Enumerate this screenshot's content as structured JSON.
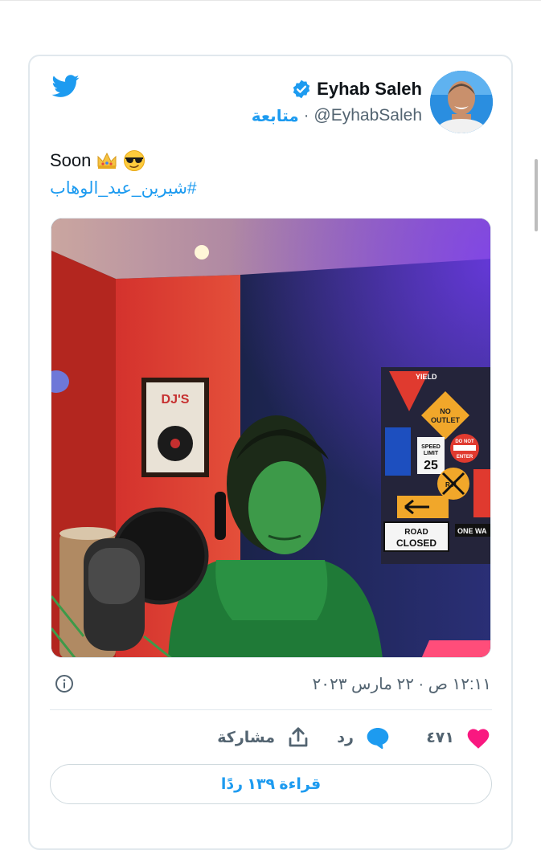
{
  "author": {
    "name": "Eyhab Saleh",
    "handle": "@EyhabSaleh",
    "follow_label": "متابعة",
    "separator": "·",
    "verified": true
  },
  "tweet": {
    "text": "Soon",
    "emojis": [
      "crown-emoji",
      "sunglasses-emoji"
    ],
    "hashtag": "#شيرين_عبد_الوهاب",
    "image_signs": {
      "dj_poster": "DJ'S",
      "road_closed": "ROAD CLOSED",
      "no_outlet": "NO OUTLET",
      "speed_limit": "25",
      "do_not_enter": "DO NOT ENTER",
      "yield": "YIELD",
      "one_way": "ONE WA",
      "rr": "R R"
    }
  },
  "meta": {
    "timestamp": "١٢:١١ ص · ٢٢ مارس ٢٠٢٣",
    "info_icon": "info-icon"
  },
  "actions": {
    "likes_count": "٤٧١",
    "reply_label": "رد",
    "share_label": "مشاركة"
  },
  "read_replies_label": "قراءة ١٣٩ ردًا",
  "colors": {
    "accent": "#1d9bf0",
    "like": "#f91880",
    "text": "#0f1419",
    "muted": "#536471",
    "border": "#e1e8ed"
  }
}
